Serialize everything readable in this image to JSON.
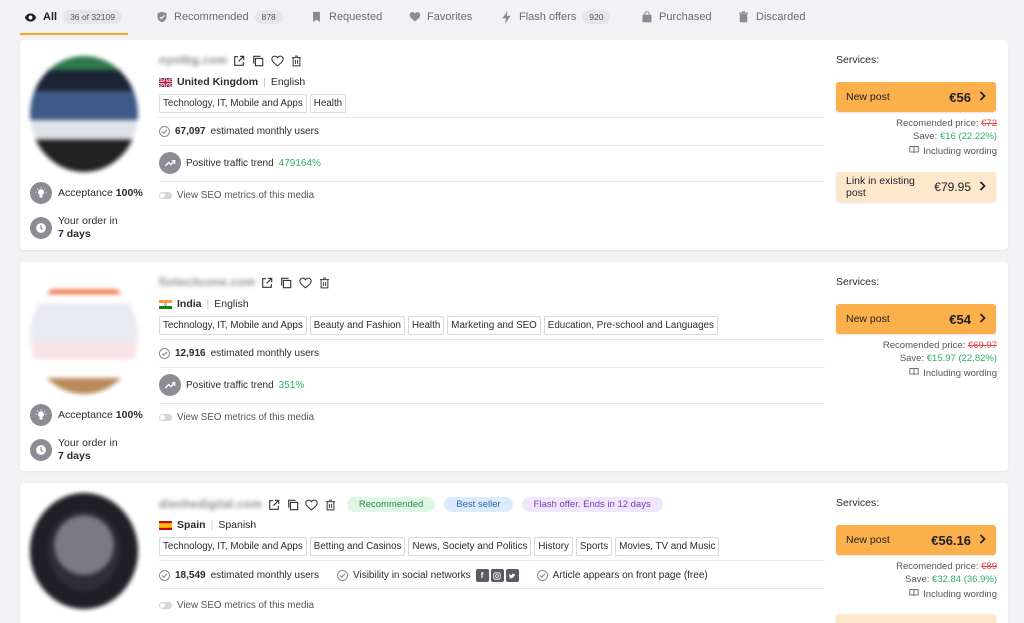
{
  "tabs": [
    {
      "label": "All",
      "count": "36 of 32109"
    },
    {
      "label": "Recommended",
      "count": "878"
    },
    {
      "label": "Requested",
      "count": ""
    },
    {
      "label": "Favorites",
      "count": ""
    },
    {
      "label": "Flash offers",
      "count": "920"
    },
    {
      "label": "Purchased",
      "count": ""
    },
    {
      "label": "Discarded",
      "count": ""
    }
  ],
  "colors": {
    "accent": "#fbb04b",
    "trend_green": "#2fb061",
    "strike_red": "#e04848"
  },
  "common": {
    "services_label": "Services:",
    "new_post_label": "New post",
    "recommended_price_label": "Recomended price:",
    "save_label": "Save:",
    "including_wording": "Including wording",
    "estimated_users_suffix": "estimated monthly users",
    "positive_trend_label": "Positive traffic trend",
    "seo_label": "View SEO metrics of this media",
    "acceptance_label": "Acceptance",
    "order_in_label": "Your order in",
    "link_existing_label": "Link in existing post"
  },
  "listings": [
    {
      "domain": "nyntbg.com",
      "flag": "uk",
      "country": "United Kingdom",
      "language": "English",
      "topics": [
        "Technology, IT, Mobile and Apps",
        "Health"
      ],
      "users": "67,097",
      "trend": "479164%",
      "acceptance": "100%",
      "order_days": "7 days",
      "new_post_price": "€56",
      "recommended_price": "€72",
      "save": "€16 (22.22%)",
      "link_existing_price": "€79.95"
    },
    {
      "domain": "fiotecitcone.com",
      "flag": "in",
      "country": "India",
      "language": "English",
      "topics": [
        "Technology, IT, Mobile and Apps",
        "Beauty and Fashion",
        "Health",
        "Marketing and SEO",
        "Education, Pre-school and Languages"
      ],
      "users": "12,916",
      "trend": "351%",
      "acceptance": "100%",
      "order_days": "7 days",
      "new_post_price": "€54",
      "recommended_price": "€69.97",
      "save": "€15.97 (22.82%)"
    },
    {
      "domain": "dienhedigital.com",
      "flag": "es",
      "country": "Spain",
      "language": "Spanish",
      "badges": [
        "Recommended",
        "Best seller",
        "Flash offer. Ends in 12 days"
      ],
      "topics": [
        "Technology, IT, Mobile and Apps",
        "Betting and Casinos",
        "News, Society and Politics",
        "History",
        "Sports",
        "Movies, TV and Music"
      ],
      "users": "18,549",
      "social_label": "Visibility in social networks",
      "front_page_label": "Article appears on front page (free)",
      "new_post_price": "€56.16",
      "recommended_price": "€89",
      "save": "€32.84 (36.9%)"
    }
  ]
}
